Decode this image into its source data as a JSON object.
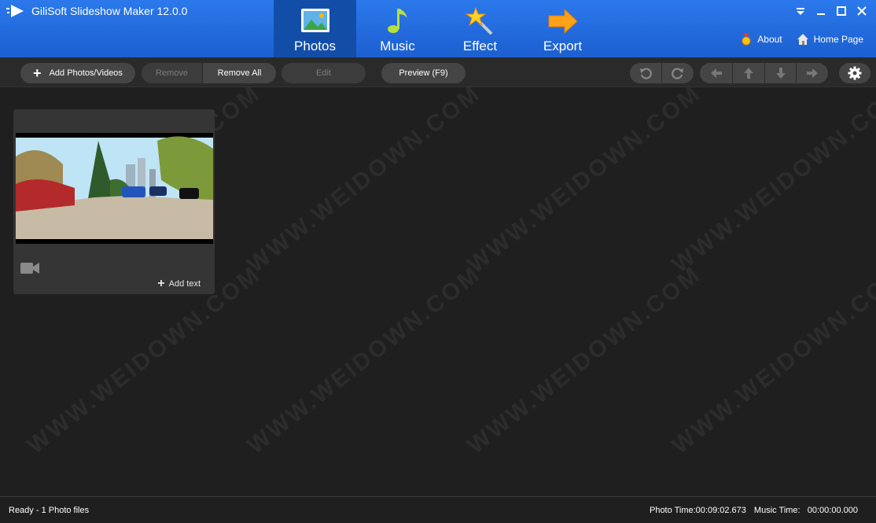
{
  "app": {
    "title": "GiliSoft Slideshow Maker 12.0.0"
  },
  "nav": {
    "tabs": [
      {
        "label": "Photos",
        "icon": "photo-icon",
        "active": true
      },
      {
        "label": "Music",
        "icon": "music-note-icon",
        "active": false
      },
      {
        "label": "Effect",
        "icon": "magic-wand-icon",
        "active": false
      },
      {
        "label": "Export",
        "icon": "arrow-right-icon",
        "active": false
      }
    ]
  },
  "header_links": {
    "about": "About",
    "home": "Home Page"
  },
  "toolbar": {
    "add": "Add Photos/Videos",
    "remove": "Remove",
    "remove_all": "Remove All",
    "edit": "Edit",
    "preview": "Preview (F9)"
  },
  "media": {
    "items": [
      {
        "type": "video",
        "add_text": "Add text"
      }
    ]
  },
  "status": {
    "left": "Ready - 1 Photo files",
    "photo_time": "Photo Time:00:09:02.673",
    "music_time": "Music Time:   00:00:00.000"
  },
  "watermark": "WWW.WEIDOWN.COM",
  "colors": {
    "header": "#1e6ae0",
    "active_tab": "#124ea8",
    "background": "#1f1f1f",
    "button": "#454545"
  }
}
